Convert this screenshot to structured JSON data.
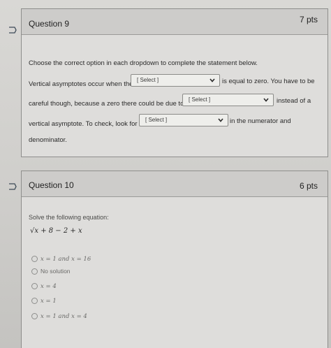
{
  "q9": {
    "title": "Question 9",
    "points": "7 pts",
    "instruction": "Choose the correct option in each dropdown to complete the statement below.",
    "line1_before": "Vertical asymptotes occur when the",
    "line1_after": "is equal to zero. You have to be",
    "line2_before": "careful though, because a zero there could be due to a",
    "line2_after": "instead of a",
    "line3_before": "vertical asymptote. To check, look for a",
    "line3_after": "in the numerator and",
    "line4": "denominator.",
    "select_placeholder": "[ Select ]"
  },
  "q10": {
    "title": "Question 10",
    "points": "6 pts",
    "prompt": "Solve the following equation:",
    "equation": "√x + 8 − 2 + x",
    "options": [
      "x = 1 and x = 16",
      "No solution",
      "x = 4",
      "x = 1",
      "x = 1 and x = 4"
    ]
  },
  "icons": {
    "flag": "flag-icon",
    "chevron": "chevron-down-icon"
  }
}
